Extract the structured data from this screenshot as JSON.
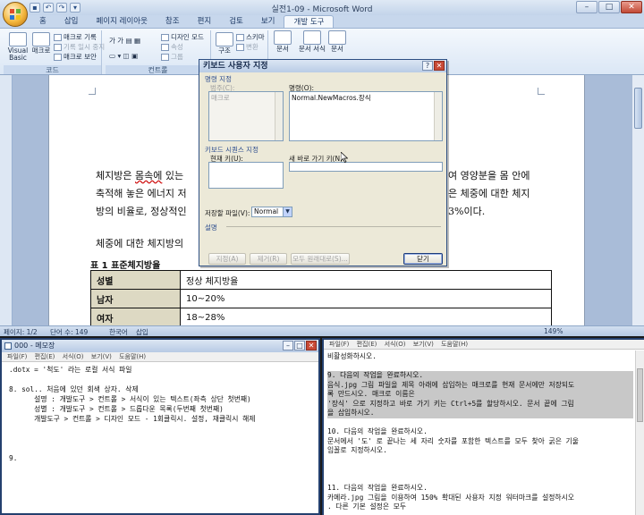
{
  "word": {
    "title": "실전1-09 - Microsoft Word",
    "tabs": [
      "홈",
      "삽입",
      "페이지 레이아웃",
      "참조",
      "편지",
      "검토",
      "보기",
      "개발 도구"
    ],
    "ribbon": {
      "visual_basic": "Visual Basic",
      "macro": "매크로",
      "record_macro": "매크로 기록",
      "pause_recording": "기록 일시 중지",
      "macro_security": "매크로 보안",
      "group_code": "코드",
      "design_mode": "디자인 모드",
      "properties": "속성",
      "group_label": "그룹",
      "group_controls": "컨트롤",
      "structure": "구조",
      "schema": "스키마",
      "transform": "변환",
      "doc_btn": "문서",
      "doc_template": "문서 서식",
      "doc2": "문서"
    },
    "document": {
      "line1_a": "체지방은 ",
      "line1_b": "몸속에",
      "line1_c": " 있는",
      "line1_right": "여 영양분을 몸 안에",
      "line2_left": "축적해 놓은 에너지 저",
      "line2_right": "은 체중에 대한 체지",
      "line3_left": "방의 비율로, 정상적인",
      "line3_right": "3%이다.",
      "line4": "체중에 대한 체지방의",
      "table_caption": "표 1 표준체지방율",
      "table": [
        [
          "성별",
          "정상 체지방율"
        ],
        [
          "남자",
          "10~20%"
        ],
        [
          "여자",
          "18~28%"
        ]
      ]
    },
    "status": {
      "page": "페이지: 1/2",
      "words": "단어 수: 149",
      "language": "한국어",
      "insert": "삽입",
      "zoom": "149%"
    }
  },
  "dialog": {
    "title": "키보드 사용자 지정",
    "command_section": "명령 지정",
    "categories_label": "범주(C):",
    "categories_item": "매크로",
    "commands_label": "명령(O):",
    "commands_item": "Normal.NewMacros.장식",
    "shortcut_section": "키보드 시퀀스 지정",
    "current_keys_label": "현재 키(U):",
    "new_key_label": "새 바로 가기 키(N):",
    "save_in_label": "저장할 파일(V):",
    "save_in_value": "Normal",
    "description_section": "설명",
    "assign_btn": "지정(A)",
    "remove_btn": "제거(R)",
    "reset_all_btn": "모두 원래대로(S)...",
    "close_btn": "닫기"
  },
  "notepad": {
    "title": "000 - 메모장",
    "menu": [
      "파일(F)",
      "편집(E)",
      "서식(O)",
      "보기(V)",
      "도움말(H)"
    ],
    "body": ".dotx = '척도' 라는 로컬 서식 파일\n\n8. sol.. 처음에 있던 회색 상자. 삭제\n      설명 : 개발도구 > 컨트롤 > 서식이 있는 텍스트(좌측 상단 첫번째)\n      성별 : 개발도구 > 컨트롤 > 드롭다운 목록(두번째 첫번째)\n      개발도구 > 컨트롤 > 디자인 모드 - 1회클릭시. 설정, 재클릭시 해제\n\n\n\n9."
  },
  "rightpane": {
    "menu": [
      "파일(F)",
      "편집(E)",
      "서식(O)",
      "보기(V)",
      "도움말(H)"
    ],
    "lines": [
      {
        "text": "   비활성화하시오.",
        "hl": false
      },
      {
        "text": "",
        "hl": false
      },
      {
        "text": "9. 다음의 작업을 완료하시오.",
        "hl": true
      },
      {
        "text": "  음식.jpg 그림 파일을 제목 아래에 삽입하는 매크로를 현재 문서에만 저장되도",
        "hl": true
      },
      {
        "text": "록 만드시오. 매크로 이름은",
        "hl": true
      },
      {
        "text": "  '장식' 으로 지정하고 바로 가기 키는 Ctrl+5를 할당하시오. 문서 끝에 그림",
        "hl": true
      },
      {
        "text": "을 삽입하시오.",
        "hl": true
      },
      {
        "text": "",
        "hl": false
      },
      {
        "text": "10. 다음의 작업을 완료하시오.",
        "hl": false
      },
      {
        "text": " 문서에서 '도' 로 끝나는 세 자리 숫자를 포함한 텍스트를 모두 찾아 굵은 기울",
        "hl": false
      },
      {
        "text": "임꼴로 지정하시오.",
        "hl": false
      },
      {
        "text": "",
        "hl": false
      },
      {
        "text": "",
        "hl": false
      },
      {
        "text": "",
        "hl": false
      },
      {
        "text": "11. 다음의 작업을 완료하시오.",
        "hl": false
      },
      {
        "text": "   카메라.jpg 그림을 이용하여 150% 확대된 사용자 지정 워터마크를 설정하시오",
        "hl": false
      },
      {
        "text": ". 다른 기본 설정은 모두",
        "hl": false
      }
    ]
  }
}
